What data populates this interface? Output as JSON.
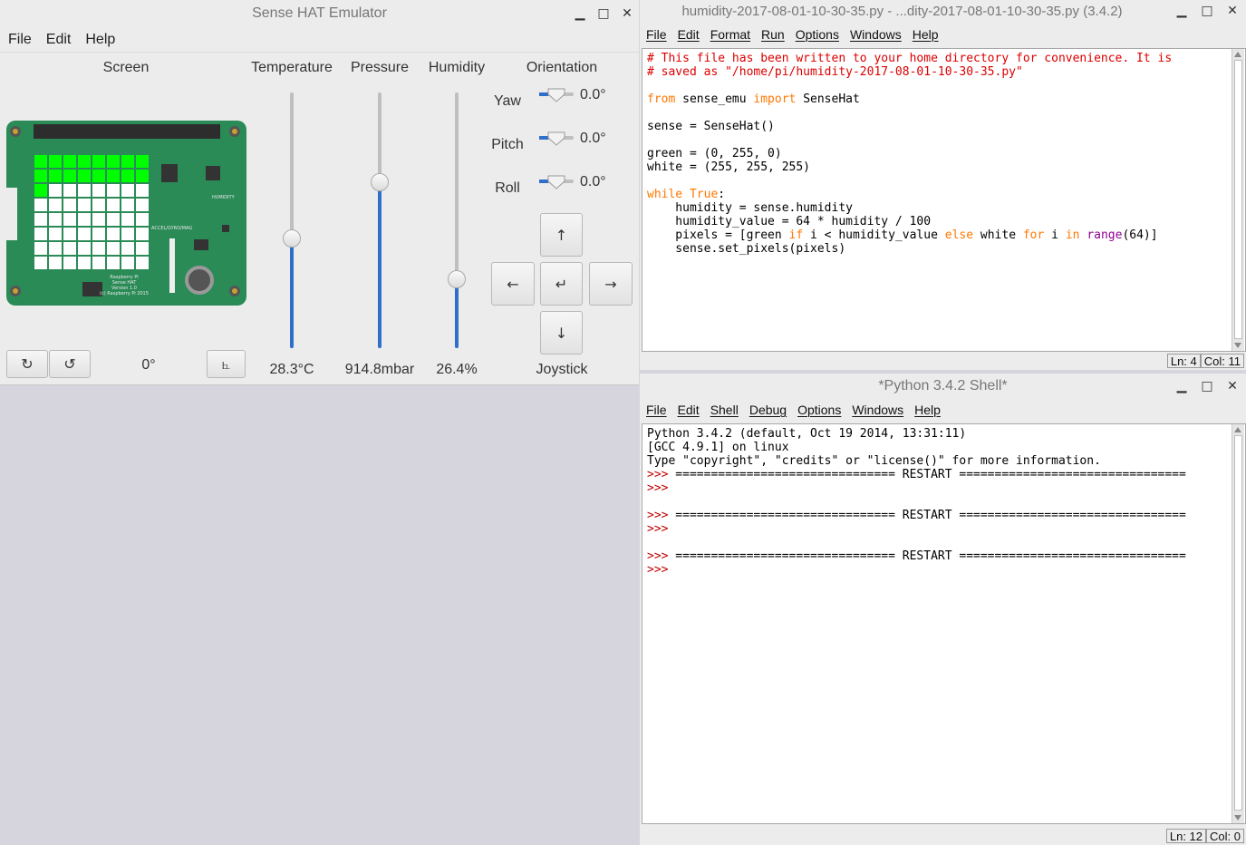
{
  "sense": {
    "title": "Sense HAT Emulator",
    "menu": [
      "File",
      "Edit",
      "Help"
    ],
    "screen_label": "Screen",
    "temperature_label": "Temperature",
    "pressure_label": "Pressure",
    "humidity_label": "Humidity",
    "orientation_label": "Orientation",
    "temperature_value": "28.3°C",
    "pressure_value": "914.8mbar",
    "humidity_value": "26.4%",
    "temperature_fraction": 0.43,
    "pressure_fraction": 0.65,
    "humidity_fraction": 0.27,
    "yaw_label": "Yaw",
    "pitch_label": "Pitch",
    "roll_label": "Roll",
    "yaw_value": "0.0°",
    "pitch_value": "0.0°",
    "roll_value": "0.0°",
    "joystick_label": "Joystick",
    "joy_up": "↑",
    "joy_left": "←",
    "joy_enter": "↵",
    "joy_right": "→",
    "joy_down": "↓",
    "rotate_cw": "↻",
    "rotate_ccw": "↺",
    "rotation_value": "0°",
    "flip_button": "⦜",
    "lit_pixels": 17,
    "pixel_on_color": "#00ff00",
    "pixel_off_color": "#ffffff",
    "board_color": "#2a8b57",
    "board_text": [
      "Raspberry Pi",
      "Sense HAT",
      "Version 1.0",
      "(c) Raspberry Pi 2015"
    ],
    "board_label_humidity": "HUMIDITY",
    "board_label_accel": "ACCEL/GYRO/MAG",
    "board_label_pressure": "PRESSURE"
  },
  "editor": {
    "title": "humidity-2017-08-01-10-30-35.py - ...dity-2017-08-01-10-30-35.py (3.4.2)",
    "menu": [
      "File",
      "Edit",
      "Format",
      "Run",
      "Options",
      "Windows",
      "Help"
    ],
    "status_ln": "Ln: 4",
    "status_col": "Col: 11",
    "code": {
      "l1": "# This file has been written to your home directory for convenience. It is",
      "l2": "# saved as \"/home/pi/humidity-2017-08-01-10-30-35.py\"",
      "l4_kw1": "from",
      "l4_mid": " sense_emu ",
      "l4_kw2": "import",
      "l4_end": " SenseHat",
      "l6": "sense = SenseHat()",
      "l8": "green = (0, 255, 0)",
      "l9": "white = (255, 255, 255)",
      "l11_kw": "while True",
      "l11_end": ":",
      "l12": "    humidity = sense.humidity",
      "l13": "    humidity_value = 64 * humidity / 100",
      "l14_a": "    pixels = [green ",
      "l14_if": "if",
      "l14_b": " i < humidity_value ",
      "l14_else": "else",
      "l14_c": " white ",
      "l14_for": "for",
      "l14_d": " i ",
      "l14_in": "in",
      "l14_e": " ",
      "l14_range": "range",
      "l14_f": "(64)]",
      "l15": "    sense.set_pixels(pixels)"
    }
  },
  "shell": {
    "title": "*Python 3.4.2 Shell*",
    "menu": [
      "File",
      "Edit",
      "Shell",
      "Debug",
      "Options",
      "Windows",
      "Help"
    ],
    "status_ln": "Ln: 12",
    "status_col": "Col: 0",
    "l1": "Python 3.4.2 (default, Oct 19 2014, 13:31:11)",
    "l2": "[GCC 4.9.1] on linux",
    "l3": "Type \"copyright\", \"credits\" or \"license()\" for more information.",
    "prompt": ">>>",
    "restart": " =============================== RESTART ================================"
  },
  "window_controls": {
    "minimize": "▁",
    "maximize": "□",
    "close": "✕"
  }
}
